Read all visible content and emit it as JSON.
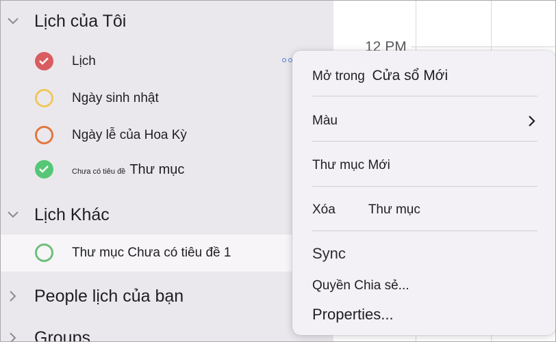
{
  "calendar": {
    "time": "12 PM"
  },
  "sidebar": {
    "my_calendars": "Lịch của Tôi",
    "other_calendars": "Lịch Khác",
    "people_calendars": "People lịch của bạn",
    "groups": "Groups",
    "items": [
      {
        "label": "Lịch",
        "checked": true,
        "color": "#d95c61"
      },
      {
        "label": "Ngày sinh nhật",
        "checked": false,
        "color": "#efc85b"
      },
      {
        "label": "Ngày lễ của Hoa Kỳ",
        "checked": false,
        "color": "#e1773d"
      },
      {
        "label_small": "Chưa có tiêu đề",
        "label_big": "Thư mục",
        "checked": true,
        "color": "#56c777"
      }
    ],
    "other_items": [
      {
        "label": "Thư mục Chưa có tiêu đề 1",
        "checked": false,
        "color": "#6cbf7a"
      }
    ]
  },
  "context_menu": {
    "open_in_part1": "Mở trong",
    "open_in_part2": "Cửa sổ Mới",
    "color": "Màu",
    "new_folder": "Thư mục Mới",
    "delete_part1": "Xóa",
    "delete_part2": "Thư mục",
    "sync": "Sync",
    "sharing": "Quyền Chia sẻ...",
    "properties": "Properties..."
  }
}
